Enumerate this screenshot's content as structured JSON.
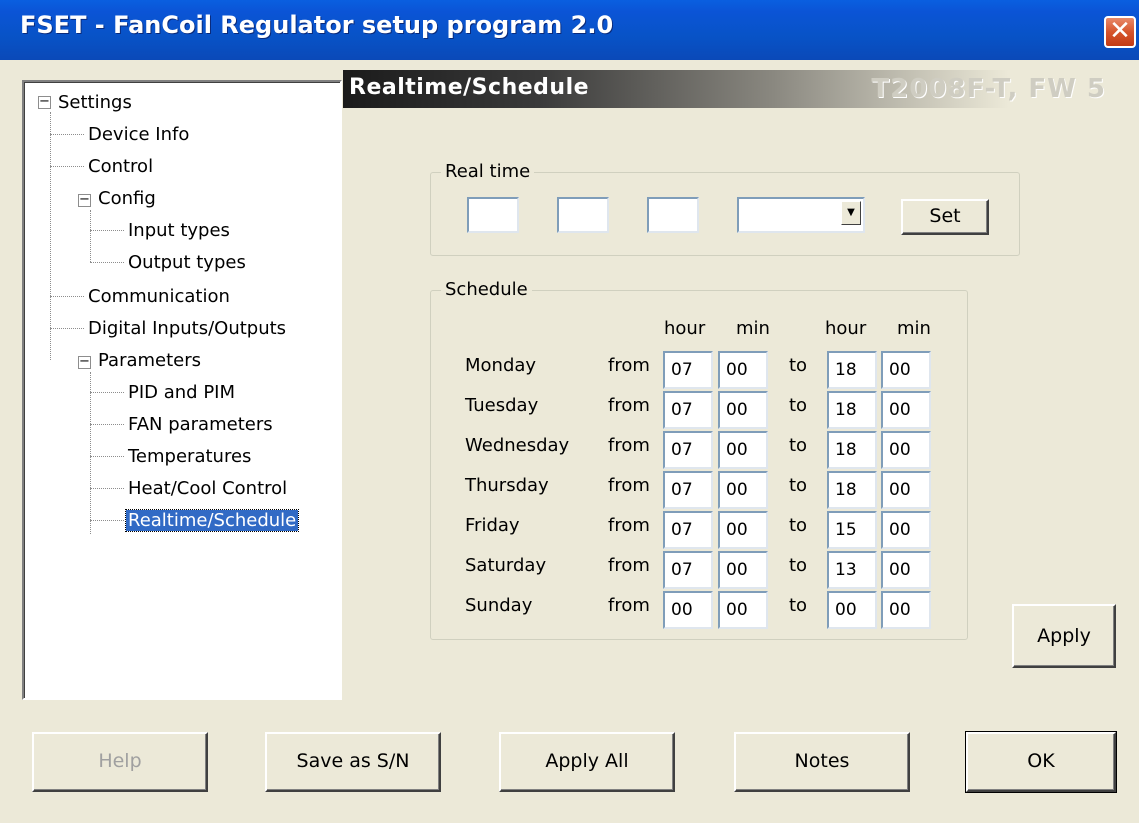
{
  "window": {
    "title": "FSET - FanCoil Regulator setup program 2.0"
  },
  "tree": {
    "items": [
      {
        "label": "Settings"
      },
      {
        "label": "Device Info"
      },
      {
        "label": "Control"
      },
      {
        "label": "Config"
      },
      {
        "label": "Input types"
      },
      {
        "label": "Output types"
      },
      {
        "label": "Communication"
      },
      {
        "label": "Digital Inputs/Outputs"
      },
      {
        "label": "Parameters"
      },
      {
        "label": "PID and PIM"
      },
      {
        "label": "FAN parameters"
      },
      {
        "label": "Temperatures"
      },
      {
        "label": "Heat/Cool Control"
      },
      {
        "label": "Realtime/Schedule"
      }
    ],
    "expander_symbol": "−"
  },
  "header": {
    "title": "Realtime/Schedule",
    "model": "T2008F-T, FW 5"
  },
  "realtime": {
    "legend": "Real time",
    "field1": "",
    "field2": "",
    "field3": "",
    "day": "",
    "set_label": "Set"
  },
  "schedule": {
    "legend": "Schedule",
    "col_hour": "hour",
    "col_min": "min",
    "from_label": "from",
    "to_label": "to",
    "rows": [
      {
        "day": "Monday",
        "from_h": "07",
        "from_m": "00",
        "to_h": "18",
        "to_m": "00"
      },
      {
        "day": "Tuesday",
        "from_h": "07",
        "from_m": "00",
        "to_h": "18",
        "to_m": "00"
      },
      {
        "day": "Wednesday",
        "from_h": "07",
        "from_m": "00",
        "to_h": "18",
        "to_m": "00"
      },
      {
        "day": "Thursday",
        "from_h": "07",
        "from_m": "00",
        "to_h": "18",
        "to_m": "00"
      },
      {
        "day": "Friday",
        "from_h": "07",
        "from_m": "00",
        "to_h": "15",
        "to_m": "00"
      },
      {
        "day": "Saturday",
        "from_h": "07",
        "from_m": "00",
        "to_h": "13",
        "to_m": "00"
      },
      {
        "day": "Sunday",
        "from_h": "00",
        "from_m": "00",
        "to_h": "00",
        "to_m": "00"
      }
    ]
  },
  "buttons": {
    "apply": "Apply",
    "help": "Help",
    "save_sn": "Save as S/N",
    "apply_all": "Apply All",
    "notes": "Notes",
    "ok": "OK"
  },
  "colors": {
    "titlebar": "#0a5fe0",
    "selection": "#316ac5",
    "dialog_bg": "#ece9d8"
  },
  "icons": {
    "close": "close-icon",
    "combo": "chevron-down-icon"
  }
}
